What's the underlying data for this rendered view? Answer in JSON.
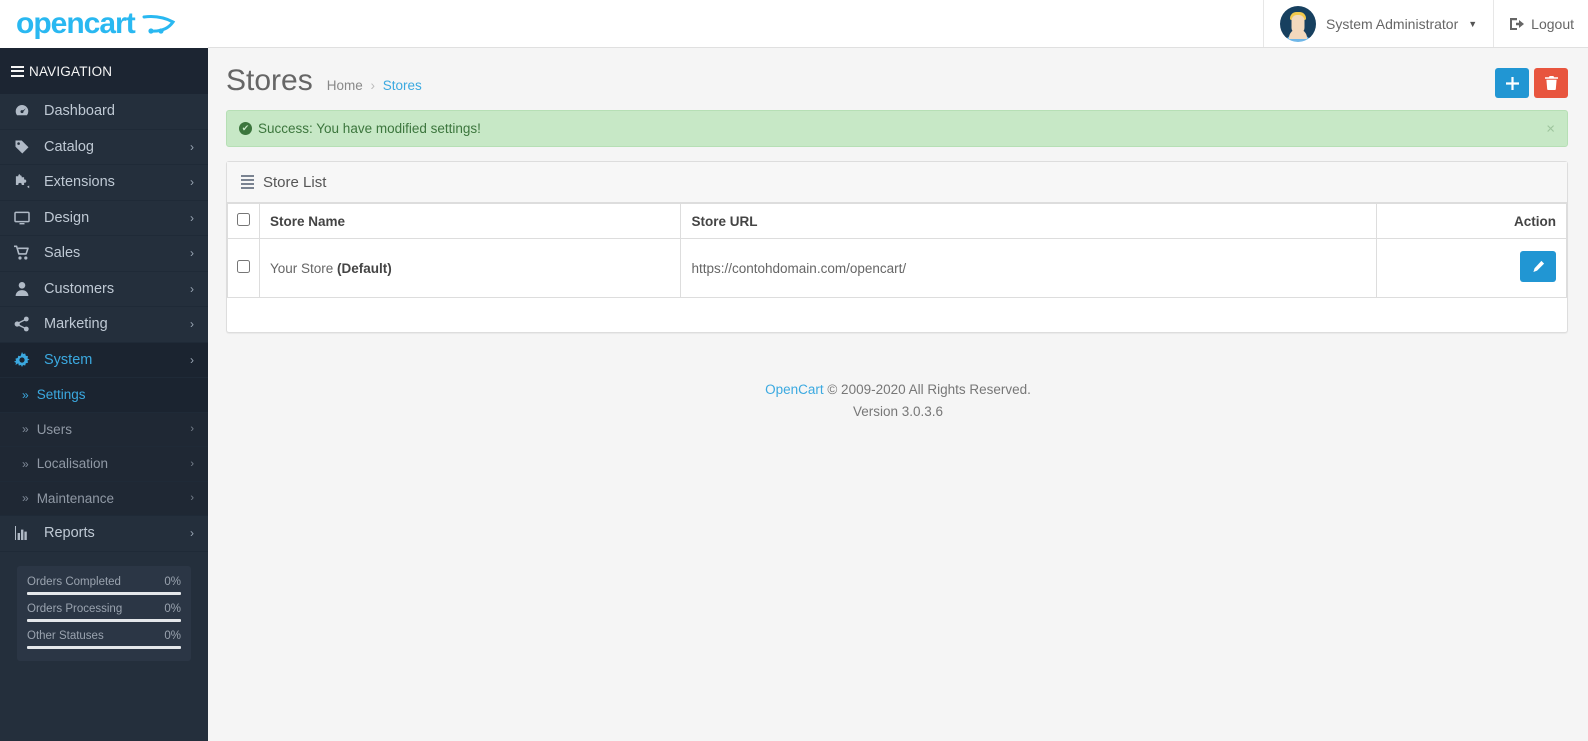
{
  "brand": {
    "logo_text": "opencart",
    "cart_icon": "shopping-cart-icon"
  },
  "sidebar": {
    "nav_header": "NAVIGATION",
    "items": [
      {
        "label": "Dashboard",
        "icon": "dashboard-icon",
        "has_chevron": false,
        "active": false
      },
      {
        "label": "Catalog",
        "icon": "tag-icon",
        "has_chevron": true,
        "active": false
      },
      {
        "label": "Extensions",
        "icon": "puzzle-icon",
        "has_chevron": true,
        "active": false
      },
      {
        "label": "Design",
        "icon": "monitor-icon",
        "has_chevron": true,
        "active": false
      },
      {
        "label": "Sales",
        "icon": "cart-icon",
        "has_chevron": true,
        "active": false
      },
      {
        "label": "Customers",
        "icon": "user-icon",
        "has_chevron": true,
        "active": false
      },
      {
        "label": "Marketing",
        "icon": "share-icon",
        "has_chevron": true,
        "active": false
      },
      {
        "label": "System",
        "icon": "gear-icon",
        "has_chevron": true,
        "active": true
      }
    ],
    "sub_items": [
      {
        "label": "Settings",
        "has_chevron": false,
        "active": true
      },
      {
        "label": "Users",
        "has_chevron": true,
        "active": false
      },
      {
        "label": "Localisation",
        "has_chevron": true,
        "active": false
      },
      {
        "label": "Maintenance",
        "has_chevron": true,
        "active": false
      }
    ],
    "items_after": [
      {
        "label": "Reports",
        "icon": "bar-chart-icon",
        "has_chevron": true,
        "active": false
      }
    ],
    "stats": [
      {
        "label": "Orders Completed",
        "value": "0%",
        "percent": 100
      },
      {
        "label": "Orders Processing",
        "value": "0%",
        "percent": 100
      },
      {
        "label": "Other Statuses",
        "value": "0%",
        "percent": 100
      }
    ]
  },
  "topbar": {
    "user_name": "System Administrator",
    "user_caret": "▼",
    "logout_label": "Logout",
    "logout_icon": "logout-icon",
    "avatar": "user-avatar"
  },
  "page": {
    "title": "Stores",
    "breadcrumb": {
      "home": "Home",
      "separator": "›",
      "current": "Stores"
    },
    "add_icon": "plus-icon",
    "delete_icon": "trash-icon"
  },
  "alert": {
    "icon": "check-circle-icon",
    "message": "Success: You have modified settings!",
    "close_label": "×"
  },
  "panel": {
    "icon": "list-icon",
    "title": "Store List",
    "columns": [
      "Store Name",
      "Store URL",
      "Action"
    ],
    "rows": [
      {
        "store_name": "Your Store ",
        "store_name_bold": "(Default)",
        "store_url": "https://contohdomain.com/opencart/",
        "edit_icon": "pencil-icon"
      }
    ]
  },
  "footer": {
    "link": "OpenCart",
    "copyright": " © 2009-2020 All Rights Reserved.",
    "version": "Version 3.0.3.6"
  },
  "colors": {
    "brand": "#29b8f1",
    "sidebar_bg": "#242f3c",
    "accent": "#2196d3",
    "danger": "#e8553e",
    "success_bg": "#c7e8c6",
    "success_text": "#3c763d"
  }
}
